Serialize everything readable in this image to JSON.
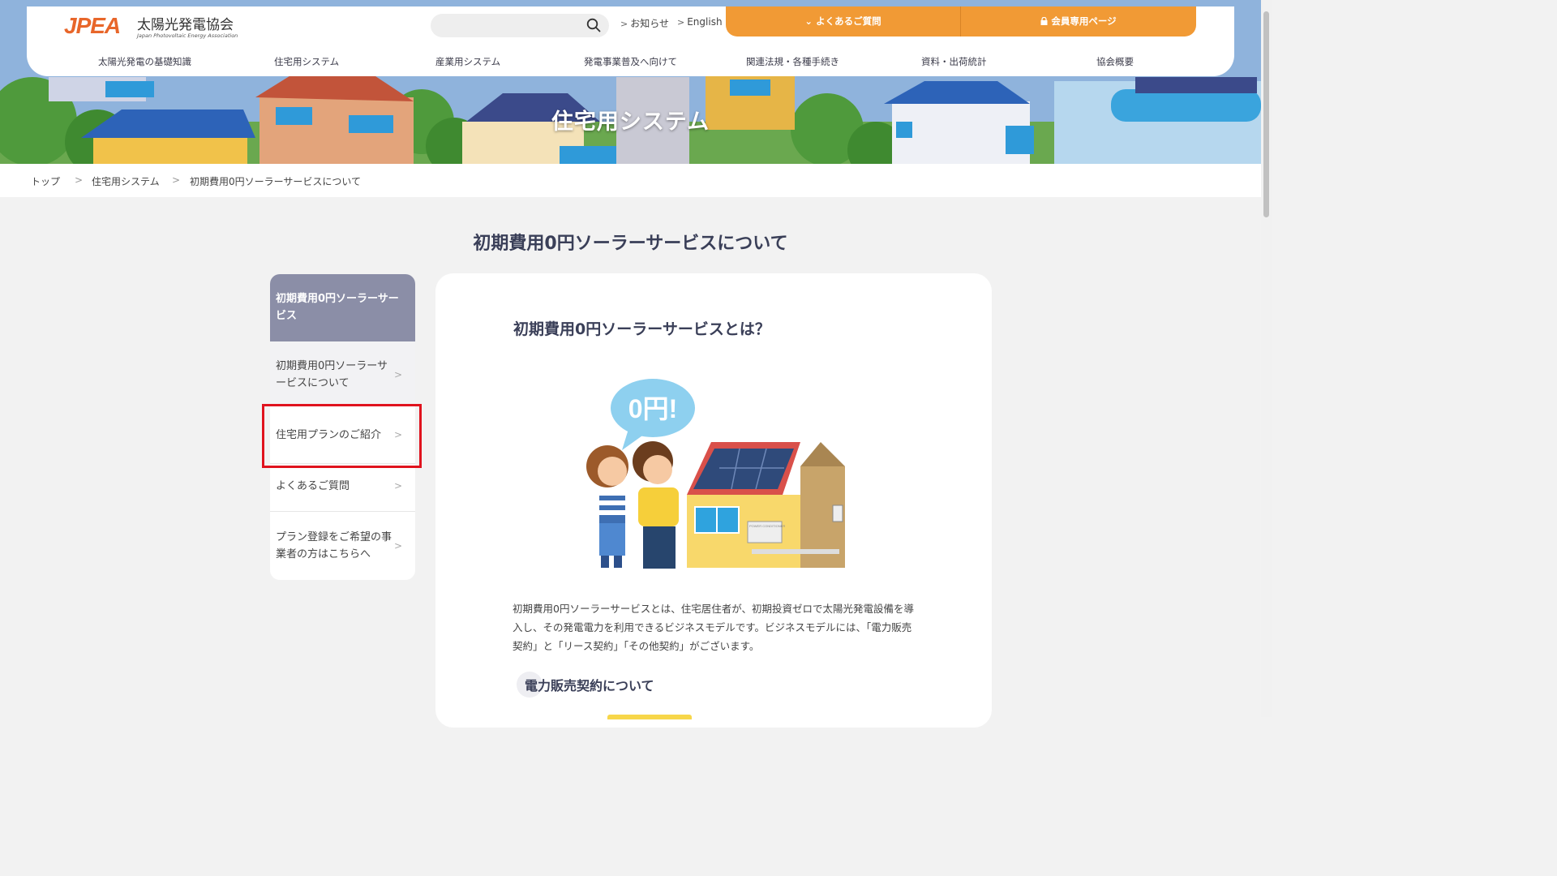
{
  "hero": {
    "title": "住宅用システム"
  },
  "header": {
    "logo": {
      "mark": "JPEA",
      "name_jp": "太陽光発電協会",
      "name_en": "Japan Photovoltaic Energy Association"
    },
    "search": {
      "placeholder": ""
    },
    "links": {
      "news": "お知らせ",
      "english": "English"
    },
    "buttons": {
      "faq": "よくあるご質問",
      "members": "会員専用ページ"
    },
    "nav": [
      "太陽光発電の基礎知識",
      "住宅用システム",
      "産業用システム",
      "発電事業普及へ向けて",
      "関連法規・各種手続き",
      "資料・出荷統計",
      "協会概要"
    ]
  },
  "breadcrumb": [
    "トップ",
    "住宅用システム",
    "初期費用0円ソーラーサービスについて"
  ],
  "page_title": "初期費用0円ソーラーサービスについて",
  "sidebar": {
    "heading": "初期費用0円ソーラーサービス",
    "items": [
      {
        "label": "初期費用0円ソーラーサービスについて"
      },
      {
        "label": "住宅用プランのご紹介"
      },
      {
        "label": "よくあるご質問"
      },
      {
        "label": "プラン登録をご希望の事業者の方はこちらへ"
      }
    ]
  },
  "content": {
    "heading": "初期費用0円ソーラーサービスとは？",
    "bubble": "0円!",
    "conditioner_label": "POWER CONDITIONER",
    "lead": "初期費用0円ソーラーサービスとは、住宅居住者が、初期投資ゼロで太陽光発電設備を導入し、その発電電力を利用できるビジネスモデルです。ビジネスモデルには、「電力販売契約」と「リース契約」「その他契約」がございます。",
    "subheading": "電力販売契約について"
  },
  "colors": {
    "accent_orange": "#f19a35",
    "sidebar_head": "#8b8ea7",
    "highlight_red": "#e0131e"
  }
}
